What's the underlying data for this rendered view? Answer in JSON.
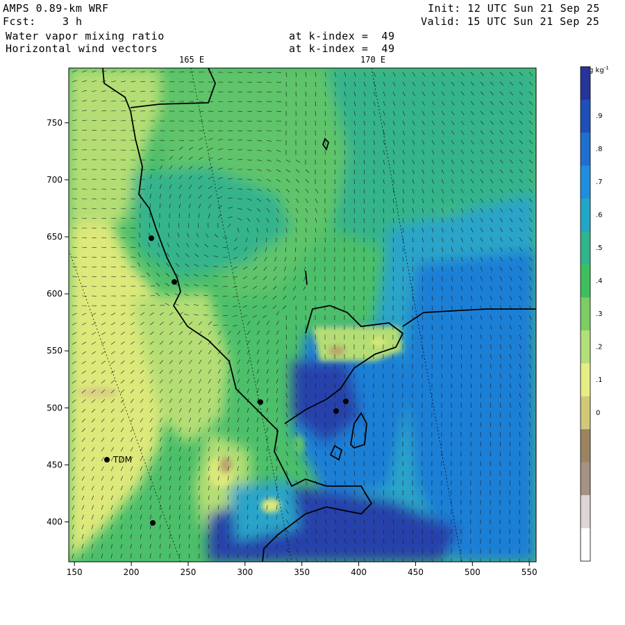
{
  "header": {
    "model": "AMPS 0.89-km WRF",
    "forecast_label": "Fcst:",
    "forecast_value": "3 h",
    "field1": "Water vapor mixing ratio",
    "field2": "Horizontal wind vectors",
    "level1": "at k-index =  49",
    "level2": "at k-index =  49",
    "init": "Init: 12 UTC Sun 21 Sep 25",
    "valid": "Valid: 15 UTC Sun 21 Sep 25"
  },
  "map": {
    "longitude_labels": [
      "165 E",
      "170 E"
    ],
    "x_ticks": [
      "150",
      "200",
      "250",
      "300",
      "350",
      "400",
      "450",
      "500",
      "550"
    ],
    "y_ticks": [
      "750",
      "700",
      "650",
      "600",
      "550",
      "500",
      "450",
      "400"
    ],
    "station_label": "TDM",
    "colors": {
      "yellow": "#dde97a",
      "light_green": "#b4de74",
      "green": "#78cc6a",
      "mid_green": "#4cbf6a",
      "teal": "#36b48c",
      "cyan": "#2aa4c8",
      "blue": "#1e7fd6",
      "dark_blue": "#2642aa",
      "tan": "#b8a66c",
      "brown": "#9b7a5c"
    }
  },
  "colorbar": {
    "unit": "g kg",
    "unit_exp": "-1",
    "labels": [
      ".9",
      ".8",
      ".7",
      ".6",
      ".5",
      ".4",
      ".3",
      ".2",
      ".1",
      "0"
    ],
    "colors": [
      "#27349a",
      "#1f4fb8",
      "#1f6fd0",
      "#1f8edf",
      "#22a6c6",
      "#2fb48c",
      "#3dbf5c",
      "#7ccd64",
      "#b3df78",
      "#e6ee82",
      "#d2c878",
      "#9c8460",
      "#a69282",
      "#ded6d4",
      "#ffffff"
    ]
  }
}
